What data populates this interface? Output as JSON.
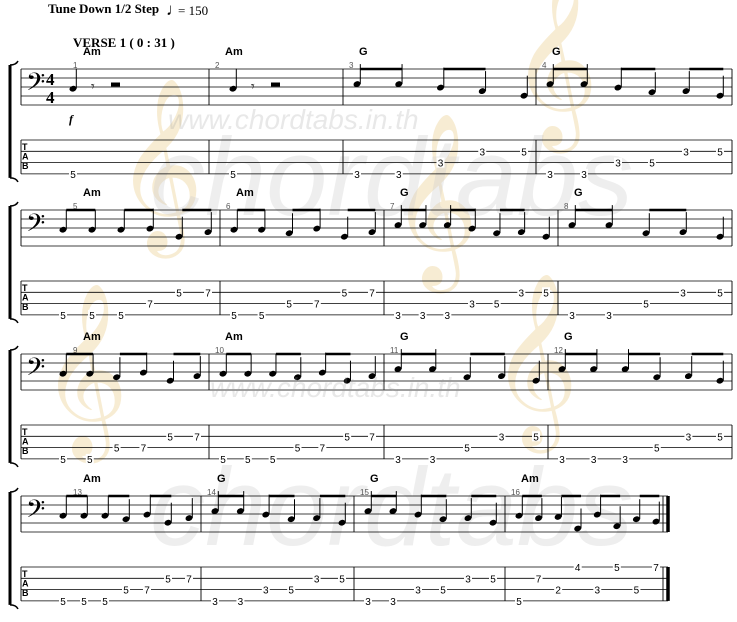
{
  "header": {
    "tuning": "Tune Down 1/2 Step",
    "tempo_symbol": "♩",
    "tempo": "= 150",
    "section": "VERSE 1 ( 0 : 31 )"
  },
  "watermark": {
    "url": "www.chordtabs.in.th",
    "brand": "chordtabs"
  },
  "clef": "bass",
  "time_signature": [
    "4",
    "4"
  ],
  "dynamic": "f",
  "tab_clef": [
    "T",
    "A",
    "B"
  ],
  "colors": {
    "ink": "#000000",
    "watermark": "#cfcfcf",
    "watermark_accent": "#f1dcae"
  },
  "systems": [
    {
      "measures": [
        {
          "number": "1",
          "chord": "Am",
          "tab": [
            {
              "s": "E",
              "f": "5"
            }
          ]
        },
        {
          "number": "2",
          "chord": "Am",
          "tab": [
            {
              "s": "E",
              "f": "5"
            }
          ]
        },
        {
          "number": "3",
          "chord": "G",
          "tab": [
            {
              "s": "E",
              "f": "3"
            },
            {
              "s": "E",
              "f": "3"
            },
            {
              "s": "A",
              "f": "3"
            },
            {
              "s": "D",
              "f": "3"
            },
            {
              "s": "D",
              "f": "5"
            }
          ]
        },
        {
          "number": "4",
          "chord": "G",
          "tab": [
            {
              "s": "E",
              "f": "3"
            },
            {
              "s": "E",
              "f": "3"
            },
            {
              "s": "A",
              "f": "3"
            },
            {
              "s": "A",
              "f": "5"
            },
            {
              "s": "D",
              "f": "3"
            },
            {
              "s": "D",
              "f": "5"
            }
          ]
        }
      ]
    },
    {
      "measures": [
        {
          "number": "5",
          "chord": "Am",
          "tab": [
            {
              "s": "E",
              "f": "5"
            },
            {
              "s": "E",
              "f": "5"
            },
            {
              "s": "E",
              "f": "5"
            },
            {
              "s": "A",
              "f": "7"
            },
            {
              "s": "D",
              "f": "5"
            },
            {
              "s": "D",
              "f": "7"
            }
          ]
        },
        {
          "number": "6",
          "chord": "Am",
          "tab": [
            {
              "s": "E",
              "f": "5"
            },
            {
              "s": "E",
              "f": "5"
            },
            {
              "s": "A",
              "f": "5"
            },
            {
              "s": "A",
              "f": "7"
            },
            {
              "s": "D",
              "f": "5"
            },
            {
              "s": "D",
              "f": "7"
            }
          ]
        },
        {
          "number": "7",
          "chord": "G",
          "tab": [
            {
              "s": "E",
              "f": "3"
            },
            {
              "s": "E",
              "f": "3"
            },
            {
              "s": "E",
              "f": "3"
            },
            {
              "s": "A",
              "f": "3"
            },
            {
              "s": "A",
              "f": "5"
            },
            {
              "s": "D",
              "f": "3"
            },
            {
              "s": "D",
              "f": "5"
            }
          ]
        },
        {
          "number": "8",
          "chord": "G",
          "tab": [
            {
              "s": "E",
              "f": "3"
            },
            {
              "s": "E",
              "f": "3"
            },
            {
              "s": "A",
              "f": "5"
            },
            {
              "s": "D",
              "f": "3"
            },
            {
              "s": "D",
              "f": "5"
            }
          ]
        }
      ]
    },
    {
      "measures": [
        {
          "number": "9",
          "chord": "Am",
          "tab": [
            {
              "s": "E",
              "f": "5"
            },
            {
              "s": "E",
              "f": "5"
            },
            {
              "s": "A",
              "f": "5"
            },
            {
              "s": "A",
              "f": "7"
            },
            {
              "s": "D",
              "f": "5"
            },
            {
              "s": "D",
              "f": "7"
            }
          ]
        },
        {
          "number": "10",
          "chord": "Am",
          "tab": [
            {
              "s": "E",
              "f": "5"
            },
            {
              "s": "E",
              "f": "5"
            },
            {
              "s": "E",
              "f": "5"
            },
            {
              "s": "A",
              "f": "5"
            },
            {
              "s": "A",
              "f": "7"
            },
            {
              "s": "D",
              "f": "5"
            },
            {
              "s": "D",
              "f": "7"
            }
          ]
        },
        {
          "number": "11",
          "chord": "G",
          "tab": [
            {
              "s": "E",
              "f": "3"
            },
            {
              "s": "E",
              "f": "3"
            },
            {
              "s": "A",
              "f": "5"
            },
            {
              "s": "D",
              "f": "3"
            },
            {
              "s": "D",
              "f": "5"
            }
          ]
        },
        {
          "number": "12",
          "chord": "G",
          "tab": [
            {
              "s": "E",
              "f": "3"
            },
            {
              "s": "E",
              "f": "3"
            },
            {
              "s": "E",
              "f": "3"
            },
            {
              "s": "A",
              "f": "5"
            },
            {
              "s": "D",
              "f": "3"
            },
            {
              "s": "D",
              "f": "5"
            }
          ]
        }
      ]
    },
    {
      "measures": [
        {
          "number": "13",
          "chord": "Am",
          "tab": [
            {
              "s": "E",
              "f": "5"
            },
            {
              "s": "E",
              "f": "5"
            },
            {
              "s": "E",
              "f": "5"
            },
            {
              "s": "A",
              "f": "5"
            },
            {
              "s": "A",
              "f": "7"
            },
            {
              "s": "D",
              "f": "5"
            },
            {
              "s": "D",
              "f": "7"
            }
          ]
        },
        {
          "number": "14",
          "chord": "G",
          "tab": [
            {
              "s": "E",
              "f": "3"
            },
            {
              "s": "E",
              "f": "3"
            },
            {
              "s": "A",
              "f": "3"
            },
            {
              "s": "A",
              "f": "5"
            },
            {
              "s": "D",
              "f": "3"
            },
            {
              "s": "D",
              "f": "5"
            }
          ]
        },
        {
          "number": "15",
          "chord": "G",
          "tab": [
            {
              "s": "E",
              "f": "3"
            },
            {
              "s": "E",
              "f": "3"
            },
            {
              "s": "A",
              "f": "3"
            },
            {
              "s": "A",
              "f": "5"
            },
            {
              "s": "D",
              "f": "3"
            },
            {
              "s": "D",
              "f": "5"
            }
          ]
        },
        {
          "number": "16",
          "chord": "Am",
          "tab": [
            {
              "s": "E",
              "f": "5"
            },
            {
              "s": "D",
              "f": "7"
            },
            {
              "s": "A",
              "f": "2"
            },
            {
              "s": "G",
              "f": "4"
            },
            {
              "s": "A",
              "f": "3"
            },
            {
              "s": "G",
              "f": "5"
            },
            {
              "s": "A",
              "f": "5"
            },
            {
              "s": "G",
              "f": "7"
            }
          ]
        }
      ]
    }
  ]
}
